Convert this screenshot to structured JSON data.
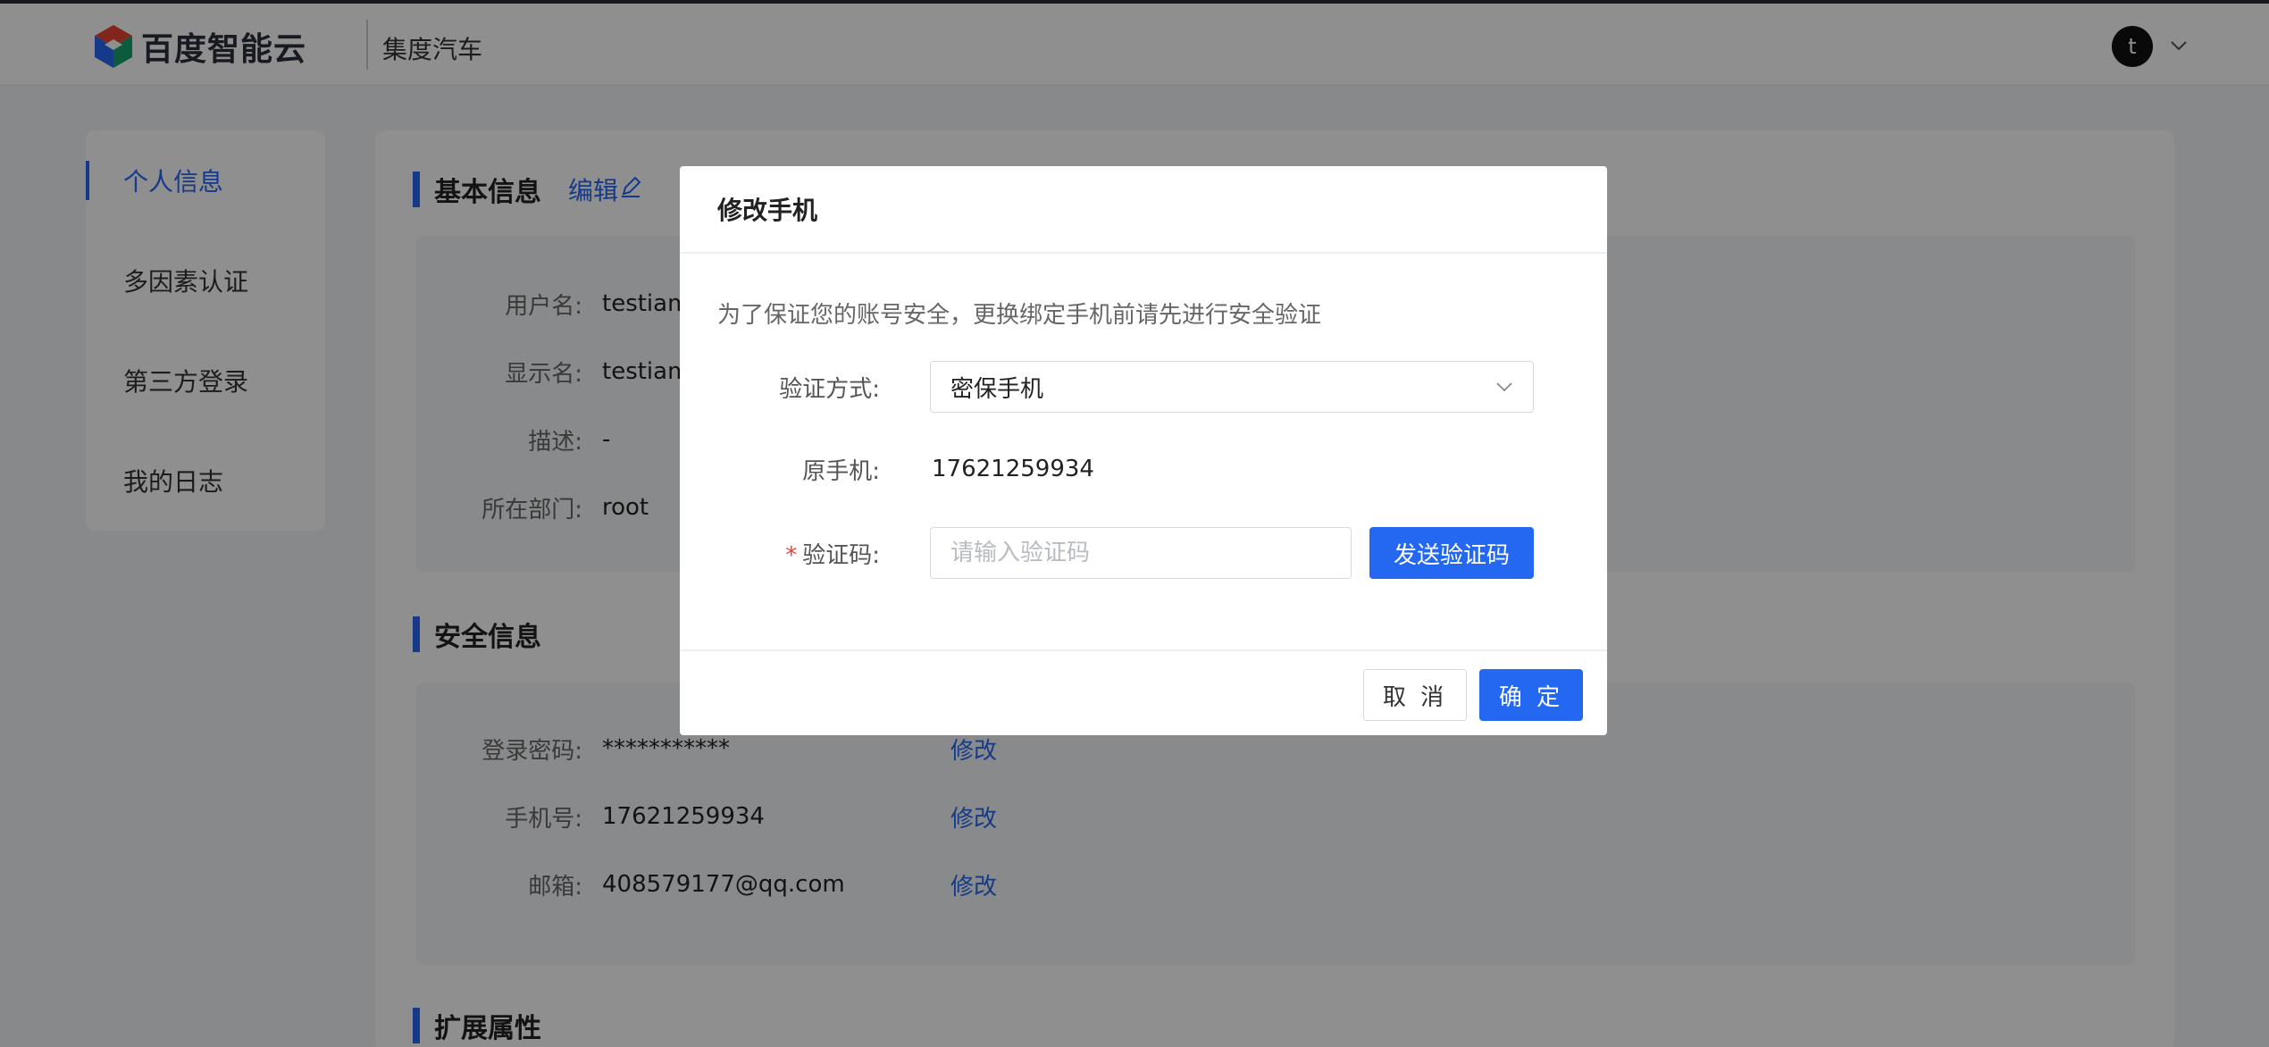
{
  "colors": {
    "accent": "#2468f2",
    "required": "#f33e3e",
    "overlay": "rgba(0,0,0,0.44)"
  },
  "header": {
    "logo_text": "百度智能云",
    "org_name": "集度汽车",
    "avatar_initial": "t",
    "avatar_menu_icon": "chevron-down-icon"
  },
  "sidebar": {
    "items": [
      {
        "label": "个人信息",
        "active": true
      },
      {
        "label": "多因素认证",
        "active": false
      },
      {
        "label": "第三方登录",
        "active": false
      },
      {
        "label": "我的日志",
        "active": false
      }
    ]
  },
  "basic_info": {
    "title": "基本信息",
    "edit_label": "编辑",
    "edit_icon": "pencil-icon",
    "fields": [
      {
        "label": "用户名:",
        "value": "testiam"
      },
      {
        "label": "显示名:",
        "value": "testiam"
      },
      {
        "label": "描述:",
        "value": "-"
      },
      {
        "label": "所在部门:",
        "value": "root"
      }
    ]
  },
  "security_info": {
    "title": "安全信息",
    "fields": [
      {
        "label": "登录密码:",
        "value": "***********",
        "action": "修改"
      },
      {
        "label": "手机号:",
        "value": "17621259934",
        "action": "修改"
      },
      {
        "label": "邮箱:",
        "value": "408579177@qq.com",
        "action": "修改"
      }
    ]
  },
  "extended_info": {
    "title": "扩展属性"
  },
  "modal": {
    "title": "修改手机",
    "tip": "为了保证您的账号安全，更换绑定手机前请先进行安全验证",
    "verify_method": {
      "label": "验证方式:",
      "value": "密保手机"
    },
    "original_phone": {
      "label": "原手机:",
      "value": "17621259934"
    },
    "code": {
      "required_mark": "*",
      "label": "验证码:",
      "placeholder": "请输入验证码",
      "value": ""
    },
    "send_code_label": "发送验证码",
    "cancel_label": "取 消",
    "confirm_label": "确 定"
  }
}
